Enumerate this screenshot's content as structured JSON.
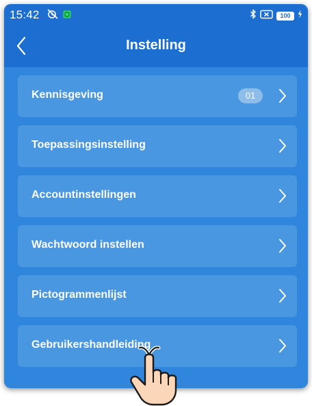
{
  "status_bar": {
    "time": "15:42",
    "battery": "100"
  },
  "header": {
    "title": "Instelling"
  },
  "menu": {
    "items": [
      {
        "label": "Kennisgeving",
        "badge": "01"
      },
      {
        "label": "Toepassingsinstelling"
      },
      {
        "label": "Accountinstellingen"
      },
      {
        "label": "Wachtwoord instellen"
      },
      {
        "label": "Pictogrammenlijst"
      },
      {
        "label": "Gebruikershandleiding"
      }
    ]
  },
  "icons": {
    "back": "chevron-left-icon",
    "item_arrow": "chevron-right-icon",
    "status": [
      "alarm-off-icon",
      "app-icon",
      "bluetooth-icon",
      "sim-off-icon",
      "battery-icon",
      "charging-icon"
    ],
    "pointer": "pointing-hand-icon"
  },
  "colors": {
    "header": "#1c6fd0",
    "background": "#2f86dc",
    "item": "#4a97e1",
    "badge": "#8ebde9",
    "text": "#ffffff"
  }
}
